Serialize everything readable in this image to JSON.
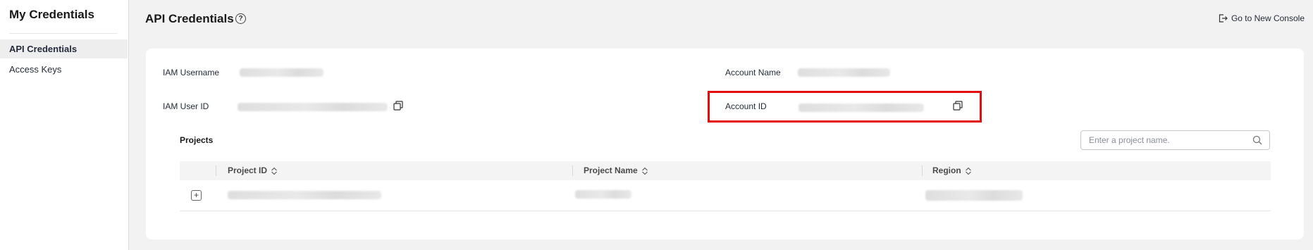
{
  "sidebar": {
    "title": "My Credentials",
    "items": [
      {
        "label": "API Credentials",
        "active": true
      },
      {
        "label": "Access Keys",
        "active": false
      }
    ]
  },
  "header": {
    "title": "API Credentials",
    "help_icon": "question-circle-icon",
    "new_console_label": "Go to New Console",
    "new_console_icon": "logout-arrow-icon"
  },
  "credentials": {
    "iam_username_label": "IAM Username",
    "iam_user_id_label": "IAM User ID",
    "account_name_label": "Account Name",
    "account_id_label": "Account ID",
    "copy_icon": "copy-icon"
  },
  "projects": {
    "title": "Projects",
    "search_placeholder": "Enter a project name.",
    "columns": [
      "Project ID",
      "Project Name",
      "Region"
    ],
    "row_expand_glyph": "+"
  },
  "colors": {
    "highlight": "#e40d0d",
    "page_bg": "#f2f2f2",
    "card_bg": "#ffffff"
  }
}
